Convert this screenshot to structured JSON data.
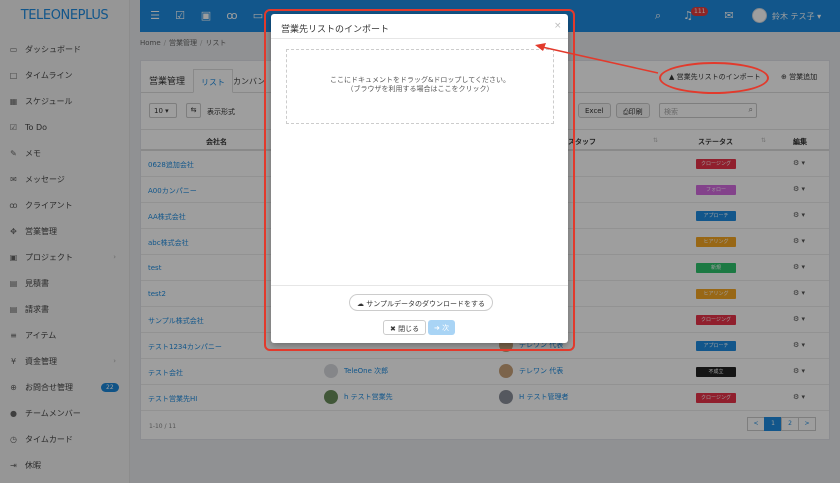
{
  "app": {
    "logo": "TELEONEPLUS"
  },
  "sidebar": {
    "items": [
      {
        "label": "ダッシュボード",
        "icon": "monitor-icon"
      },
      {
        "label": "タイムライン",
        "icon": "square-icon"
      },
      {
        "label": "スケジュール",
        "icon": "calendar-icon"
      },
      {
        "label": "To Do",
        "icon": "checkbox-icon"
      },
      {
        "label": "メモ",
        "icon": "edit-icon"
      },
      {
        "label": "メッセージ",
        "icon": "mail-icon"
      },
      {
        "label": "クライアント",
        "icon": "group-icon"
      },
      {
        "label": "営業管理",
        "icon": "handshake-icon"
      },
      {
        "label": "プロジェクト",
        "icon": "folder-icon"
      },
      {
        "label": "見積書",
        "icon": "file-icon"
      },
      {
        "label": "請求書",
        "icon": "file-icon"
      },
      {
        "label": "アイテム",
        "icon": "list-icon"
      },
      {
        "label": "資金管理",
        "icon": "yen-icon"
      },
      {
        "label": "お問合せ管理",
        "icon": "help-icon",
        "count": "22"
      },
      {
        "label": "チームメンバー",
        "icon": "user-icon"
      },
      {
        "label": "タイムカード",
        "icon": "clock-icon"
      },
      {
        "label": "休暇",
        "icon": "signout-icon"
      }
    ]
  },
  "topbar": {
    "notif_count": "111",
    "user_name": "鈴木 テス子"
  },
  "breadcrumb": {
    "home": "Home",
    "section": "営業管理",
    "current": "リスト"
  },
  "panel": {
    "title": "営業管理",
    "tab_list": "リスト",
    "tab_kanban": "カンバン",
    "import_label": "営業先リストのインポート",
    "add_label": "営業追加",
    "perpage": "10",
    "columns_label": "表示形式",
    "excel": "Excel",
    "print": "印刷",
    "search_placeholder": "検索"
  },
  "table": {
    "headers": {
      "name": "会社名",
      "staff": "スタッフ",
      "status": "ステータス",
      "edit": "編集"
    },
    "rows": [
      {
        "name": "0628追加会社",
        "status": "クロージング",
        "status_color": "#e8334a"
      },
      {
        "name": "A00カンパニー",
        "status": "フォロー",
        "status_color": "#d36be0"
      },
      {
        "name": "AA株式会社",
        "status": "アプローチ",
        "status_color": "#1d8ce0"
      },
      {
        "name": "abc株式会社",
        "status": "ヒアリング",
        "status_color": "#f5a623"
      },
      {
        "name": "test",
        "status": "新規",
        "status_color": "#2ec46d"
      },
      {
        "name": "test2",
        "status": "ヒアリング",
        "status_color": "#f5a623"
      },
      {
        "name": "サンプル株式会社",
        "status": "クロージング",
        "status_color": "#e8334a"
      },
      {
        "name": "テスト1234カンパニー",
        "staff": "テレワン 代表",
        "status": "アプローチ",
        "status_color": "#1d8ce0"
      },
      {
        "name": "テスト会社",
        "user": "TeleOne 次郎",
        "staff": "テレワン 代表",
        "status": "不成立",
        "status_color": "#222222"
      },
      {
        "name": "テスト営業先HI",
        "user": "h テスト営業先",
        "staff": "H テスト管理者",
        "status": "クロージング",
        "status_color": "#e8334a"
      }
    ],
    "page_info": "1-10 / 11",
    "pager": [
      "<",
      "1",
      "2",
      ">"
    ]
  },
  "modal": {
    "title": "営業先リストのインポート",
    "close_x": "×",
    "drop_line1": "ここにドキュメントをドラッグ&ドロップしてください。",
    "drop_line2": "（ブラウザを利用する場合はここをクリック）",
    "sample_download": "サンプルデータのダウンロードをする",
    "close_btn": "閉じる",
    "next_btn": "次"
  },
  "annotations": {
    "color": "#e23a2c"
  }
}
